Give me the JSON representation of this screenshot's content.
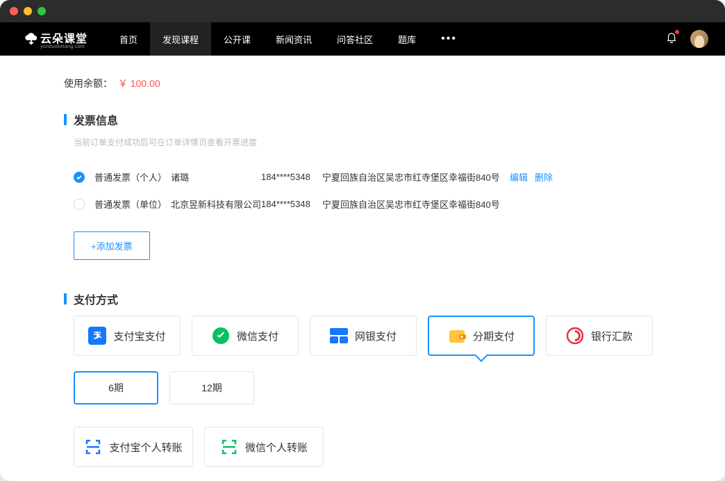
{
  "brand": {
    "name": "云朵课堂",
    "sub": "yunduoketang.com"
  },
  "nav": [
    "首页",
    "发现课程",
    "公开课",
    "新闻资讯",
    "问答社区",
    "题库"
  ],
  "nav_active_index": 1,
  "balance": {
    "label": "使用余额：",
    "amount": "￥ 100.00"
  },
  "invoice": {
    "title": "发票信息",
    "hint": "当前订单支付成功后可在订单详情页查看开票进度",
    "rows": [
      {
        "type": "普通发票（个人）",
        "name": "诸璐",
        "phone": "184****5348",
        "addr": "宁夏回族自治区吴忠市红寺堡区幸福街840号",
        "selected": true,
        "edit": "编辑",
        "delete": "删除"
      },
      {
        "type": "普通发票（单位）",
        "name": "北京昱新科技有限公司",
        "phone": "184****5348",
        "addr": "宁夏回族自治区吴忠市红寺堡区幸福街840号",
        "selected": false
      }
    ],
    "add_label": "+添加发票"
  },
  "payment": {
    "title": "支付方式",
    "methods": [
      {
        "key": "alipay",
        "label": "支付宝支付",
        "selected": false
      },
      {
        "key": "wechat",
        "label": "微信支付",
        "selected": false
      },
      {
        "key": "unionpay",
        "label": "网银支付",
        "selected": false
      },
      {
        "key": "installment",
        "label": "分期支付",
        "selected": true
      },
      {
        "key": "bank",
        "label": "银行汇款",
        "selected": false
      }
    ],
    "terms": [
      {
        "label": "6期",
        "selected": true
      },
      {
        "label": "12期",
        "selected": false
      }
    ],
    "transfers": [
      {
        "key": "alipay-personal",
        "label": "支付宝个人转账"
      },
      {
        "key": "wechat-personal",
        "label": "微信个人转账"
      }
    ]
  }
}
